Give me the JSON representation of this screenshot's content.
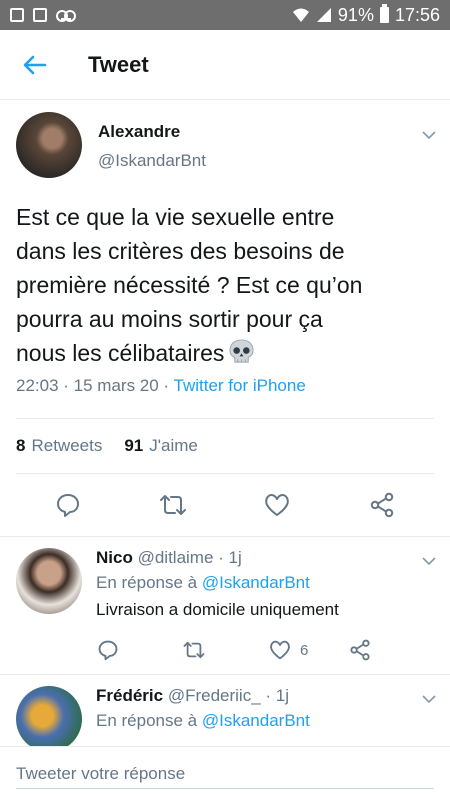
{
  "status_bar": {
    "battery": "91%",
    "time": "17:56"
  },
  "header": {
    "title": "Tweet"
  },
  "tweet": {
    "name": "Alexandre",
    "handle": "@IskandarBnt",
    "text": "Est ce que la vie sexuelle entre\ndans les critères des besoins de\npremière nécessité ? Est ce qu’on\npourra au moins sortir pour ça\nnous les célibataires",
    "time": "22:03",
    "date": "15 mars 20",
    "source": "Twitter for iPhone",
    "retweets_count": "8",
    "retweets_label": "Retweets",
    "likes_count": "91",
    "likes_label": "J'aime"
  },
  "replies": [
    {
      "name": "Nico",
      "handle": "@ditlaime",
      "age": "1j",
      "reply_prefix": "En réponse à",
      "reply_to": "@IskandarBnt",
      "text": "Livraison a domicile uniquement",
      "likes": "6"
    },
    {
      "name": "Frédéric",
      "handle": "@Frederiic_",
      "age": "1j",
      "reply_prefix": "En réponse à",
      "reply_to": "@IskandarBnt"
    }
  ],
  "compose": {
    "placeholder": "Tweeter votre réponse"
  },
  "colors": {
    "accent": "#1da1f2",
    "secondary": "#657786",
    "status_bar": "#6e6e6e"
  }
}
